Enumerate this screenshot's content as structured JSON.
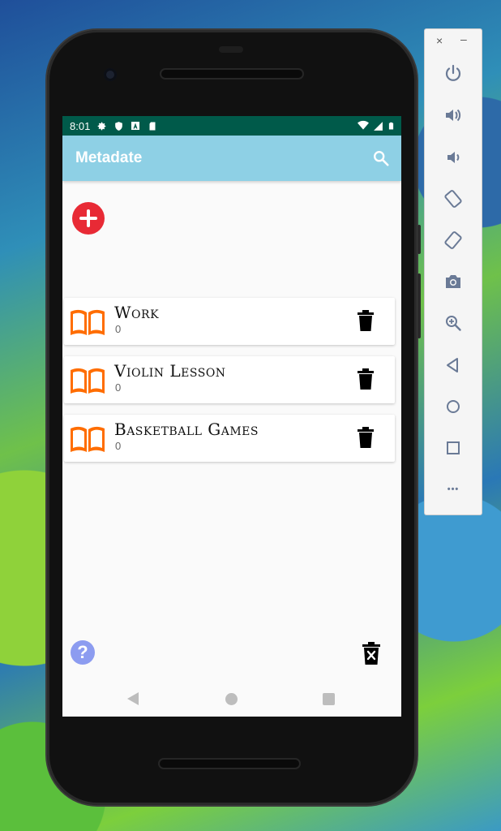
{
  "status_bar": {
    "time": "8:01"
  },
  "app_bar": {
    "title": "Metadate"
  },
  "agendas": [
    {
      "name": "Work",
      "count": "0"
    },
    {
      "name": "Violin Lesson",
      "count": "0"
    },
    {
      "name": "Basketball Games",
      "count": "0"
    }
  ],
  "help": {
    "symbol": "?"
  },
  "toolbar": {
    "close": "×",
    "minimize": "–",
    "more": "•••"
  },
  "colors": {
    "app_bar": "#8ed0e5",
    "status_bar": "#005a4a",
    "add_button": "#e82a35",
    "book_icon": "#ff6d00",
    "help_button": "#8c9cf0"
  }
}
